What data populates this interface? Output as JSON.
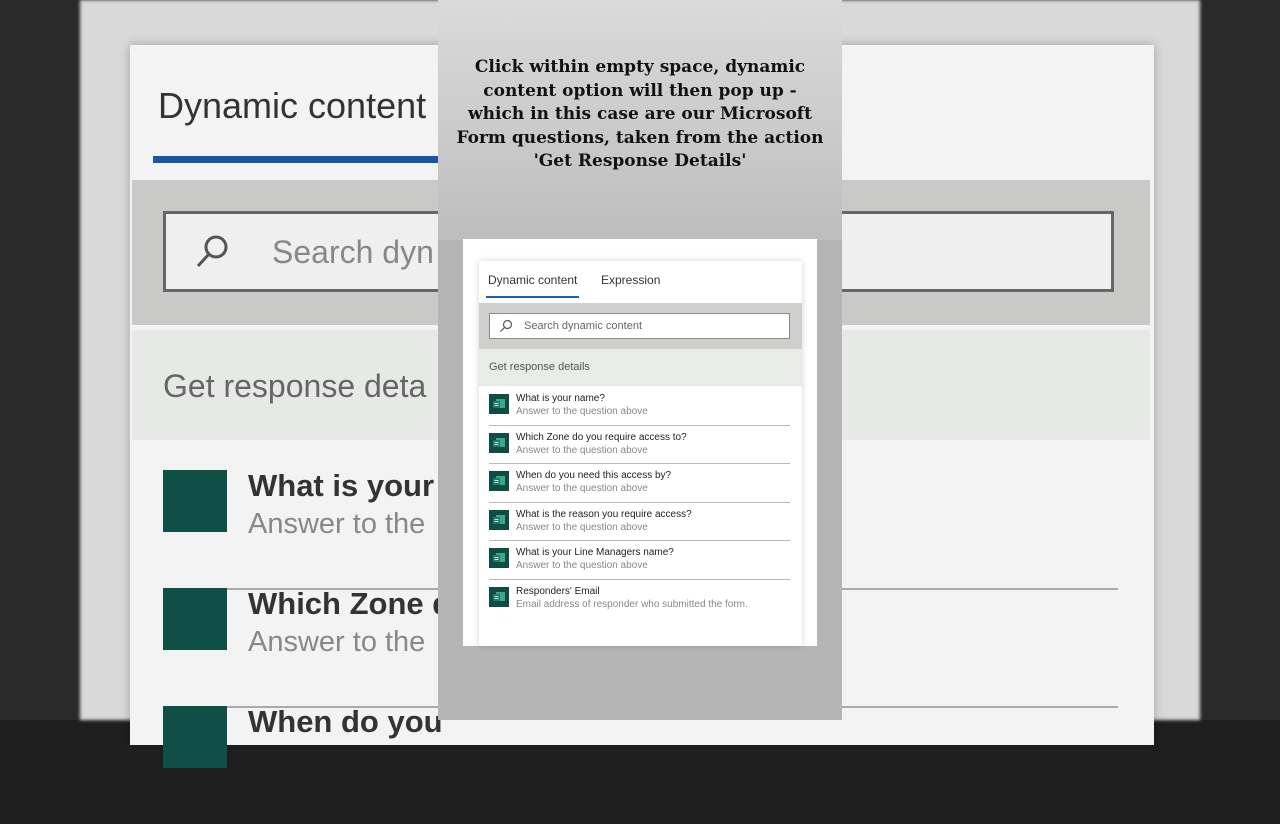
{
  "caption": "Click within empty space, dynamic content option will then pop up - which in this case are our Microsoft Form questions, taken from the action 'Get Response Details'",
  "background": {
    "title": "Dynamic content",
    "search_placeholder": "Search dyn",
    "group_label": "Get response deta",
    "rows": [
      {
        "name": "What is your",
        "desc": "Answer to the"
      },
      {
        "name": "Which Zone d",
        "desc": "Answer to the"
      },
      {
        "name": "When do you",
        "desc": ""
      }
    ]
  },
  "panel": {
    "tabs": [
      {
        "label": "Dynamic content",
        "active": true
      },
      {
        "label": "Expression",
        "active": false
      }
    ],
    "search": {
      "placeholder": "Search dynamic content"
    },
    "group_label": "Get response details",
    "items": [
      {
        "name": "What is your name?",
        "desc": "Answer to the question above",
        "icon": "forms-icon"
      },
      {
        "name": "Which Zone do you require access to?",
        "desc": "Answer to the question above",
        "icon": "forms-icon"
      },
      {
        "name": "When do you need this access by?",
        "desc": "Answer to the question above",
        "icon": "forms-icon"
      },
      {
        "name": "What is the reason you require access?",
        "desc": "Answer to the question above",
        "icon": "forms-icon"
      },
      {
        "name": "What is your Line Managers name?",
        "desc": "Answer to the question above",
        "icon": "forms-icon"
      },
      {
        "name": "Responders' Email",
        "desc": "Email address of responder who submitted the form.",
        "icon": "forms-icon"
      }
    ]
  },
  "colors": {
    "accent": "#1e5fbb",
    "forms_tile": "#0d4d43"
  }
}
